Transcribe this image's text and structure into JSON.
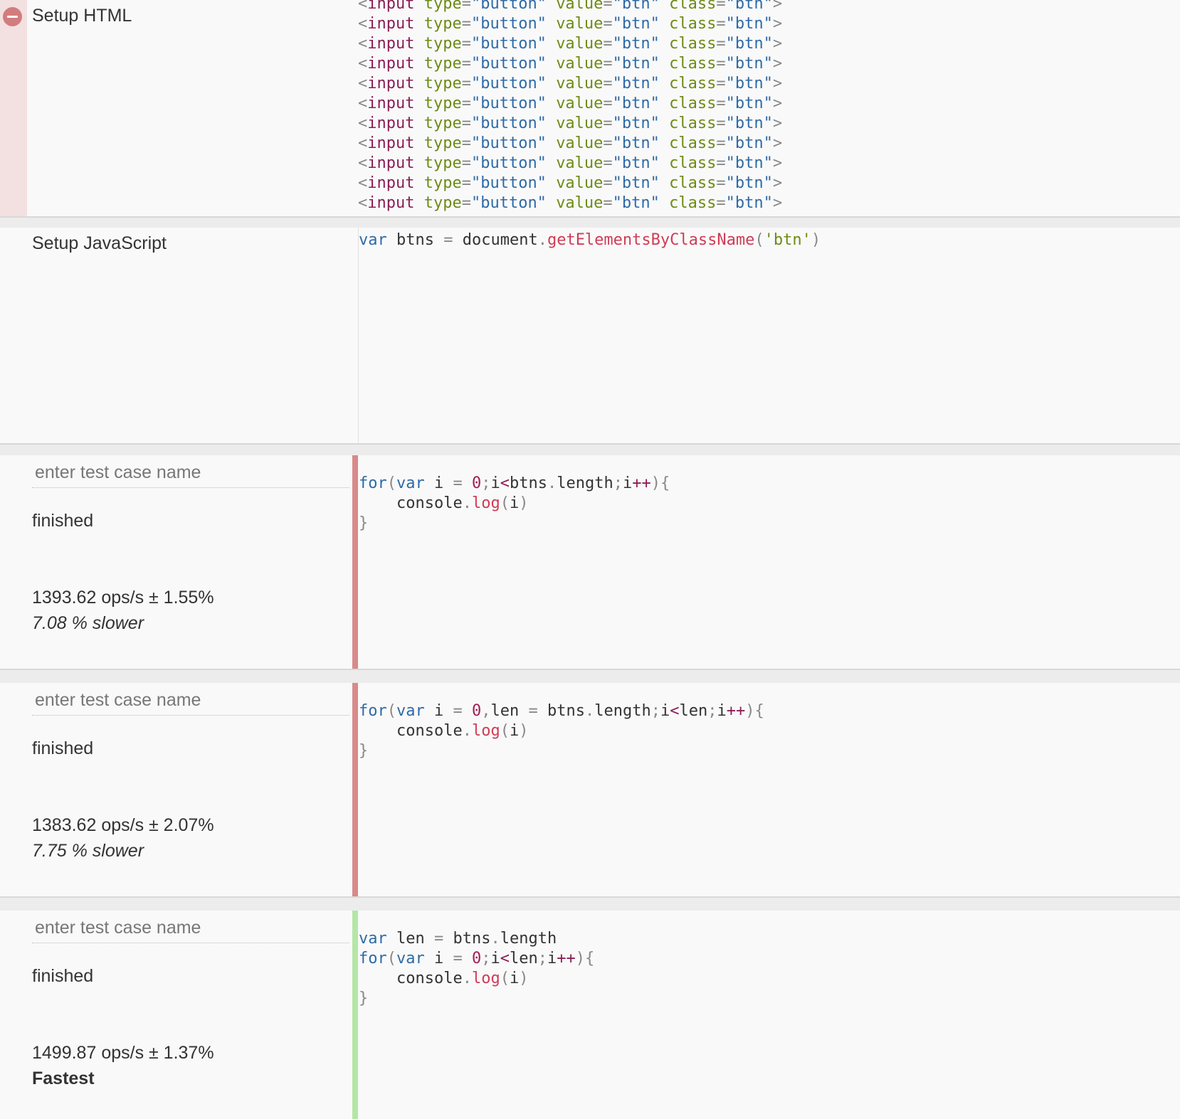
{
  "setup_html": {
    "title": "Setup HTML",
    "remove_icon": "minus-circle-icon",
    "line": {
      "open": "<",
      "tag": "input",
      "attr_type": "type",
      "eq": "=",
      "val_type": "\"button\"",
      "attr_value": "value",
      "val_value": "\"btn\"",
      "attr_class": "class",
      "val_class": "\"btn\"",
      "close": ">"
    },
    "line_count": 11
  },
  "setup_js": {
    "title": "Setup JavaScript",
    "code": {
      "kw": "var",
      "name": " btns ",
      "op": "=",
      "obj": " document",
      "dot": ".",
      "method": "getElementsByClassName",
      "lp": "(",
      "arg": "'btn'",
      "rp": ")"
    }
  },
  "colors": {
    "slower_bar": "#d88a8a",
    "fastest_bar": "#b5e6a6"
  },
  "test_cases": [
    {
      "name_placeholder": "enter test case name",
      "status": "finished",
      "ops": "1393.62 ops/s ± 1.55%",
      "relative": "7.08 % slower",
      "bar_color": "#d88a8a"
    },
    {
      "name_placeholder": "enter test case name",
      "status": "finished",
      "ops": "1383.62 ops/s ± 2.07%",
      "relative": "7.75 % slower",
      "bar_color": "#d88a8a"
    },
    {
      "name_placeholder": "enter test case name",
      "status": "finished",
      "ops": "1499.87 ops/s ± 1.37%",
      "relative": "Fastest",
      "bar_color": "#b5e6a6"
    }
  ],
  "code_tokens": {
    "for": "for",
    "var": "var",
    "lp": "(",
    "rp": ")",
    "lb": "{",
    "rb": "}",
    "eq": "=",
    "zero": "0",
    "semi": ";",
    "comma": ",",
    "lt": "<",
    "inc": "++",
    "dot": ".",
    "i": "i",
    "btns": "btns",
    "length": "length",
    "len": "len",
    "console": "console",
    "log": "log"
  }
}
